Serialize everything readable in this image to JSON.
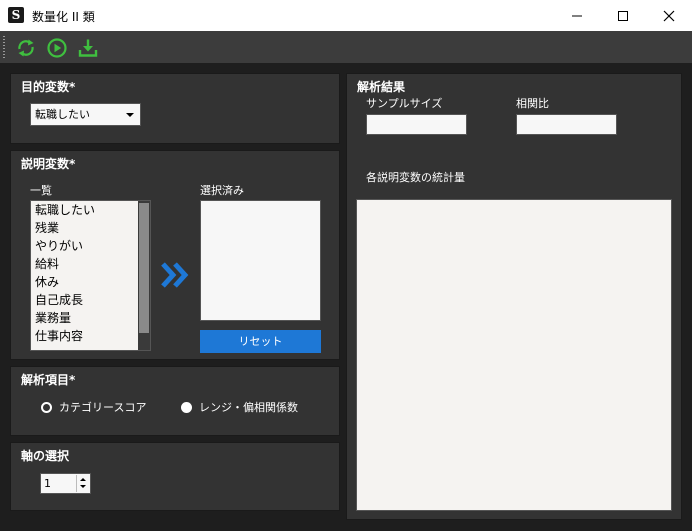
{
  "window": {
    "title": "数量化 II 類",
    "app_icon_letter": "S",
    "minimize_icon": "minimize-icon",
    "maximize_icon": "maximize-icon",
    "close_icon": "close-icon"
  },
  "toolbar": {
    "accent": "#3fbf3f",
    "buttons": [
      {
        "icon": "refresh-icon"
      },
      {
        "icon": "play-icon"
      },
      {
        "icon": "download-icon"
      }
    ]
  },
  "objective": {
    "title": "目的変数*",
    "selected": "転職したい"
  },
  "explanatory": {
    "title": "説明変数*",
    "list_label": "一覧",
    "selected_label": "選択済み",
    "items": [
      "転職したい",
      "残業",
      "やりがい",
      "給料",
      "休み",
      "自己成長",
      "業務量",
      "仕事内容"
    ],
    "move_icon": "double-chevron-right-icon",
    "reset_label": "リセット",
    "accent": "#1e78d6"
  },
  "analysis": {
    "title": "解析項目*",
    "options": [
      {
        "label": "カテゴリースコア",
        "checked": true
      },
      {
        "label": "レンジ・偏相関係数",
        "checked": false
      }
    ]
  },
  "axis": {
    "title": "軸の選択",
    "value": "1"
  },
  "results": {
    "title": "解析結果",
    "sample_size_label": "サンプルサイズ",
    "sample_size_value": "",
    "correlation_ratio_label": "相関比",
    "correlation_ratio_value": "",
    "stats_label": "各説明変数の統計量"
  }
}
